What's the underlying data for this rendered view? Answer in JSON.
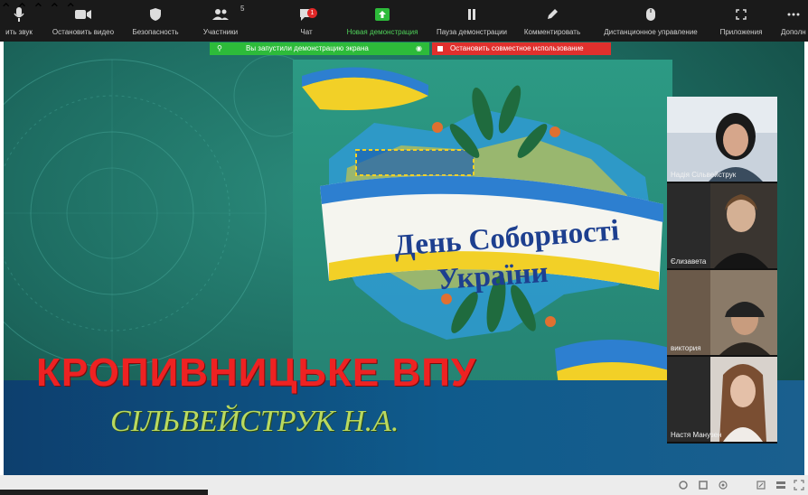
{
  "toolbar": {
    "items": [
      {
        "label": "ить звук",
        "icon": "microphone-icon"
      },
      {
        "label": "Остановить видео",
        "icon": "video-camera-icon"
      },
      {
        "label": "Безопасность",
        "icon": "shield-icon"
      },
      {
        "label": "Участники",
        "icon": "participants-icon",
        "count": "5"
      },
      {
        "label": "Чат",
        "icon": "chat-icon",
        "badge": "1"
      },
      {
        "label": "Новая демонстрация",
        "icon": "share-screen-icon"
      },
      {
        "label": "Пауза демонстрации",
        "icon": "pause-icon"
      },
      {
        "label": "Комментировать",
        "icon": "pen-icon"
      },
      {
        "label": "Дистанционное управление",
        "icon": "mouse-icon"
      },
      {
        "label": "Приложения",
        "icon": "apps-icon"
      },
      {
        "label": "Дополн",
        "icon": "more-icon"
      }
    ]
  },
  "share_banner": {
    "status": "Вы запустили демонстрацию экрана",
    "stop": "Остановить совместное использование"
  },
  "slide": {
    "poster_line1": "День Соборності",
    "poster_line2": "України",
    "title": "КРОПИВНИЦЬКЕ ВПУ",
    "subtitle": "СІЛЬВЕЙСТРУК Н.А."
  },
  "participants": [
    {
      "name": "Надія Сільвейструк"
    },
    {
      "name": "Єлизавета"
    },
    {
      "name": "виктория"
    },
    {
      "name": "Настя Манузен"
    }
  ],
  "colors": {
    "active_share_green": "#2dbb3a",
    "stop_red": "#e0302d",
    "badge_red": "#e02828",
    "toolbar_bg": "#1a1a1a"
  }
}
